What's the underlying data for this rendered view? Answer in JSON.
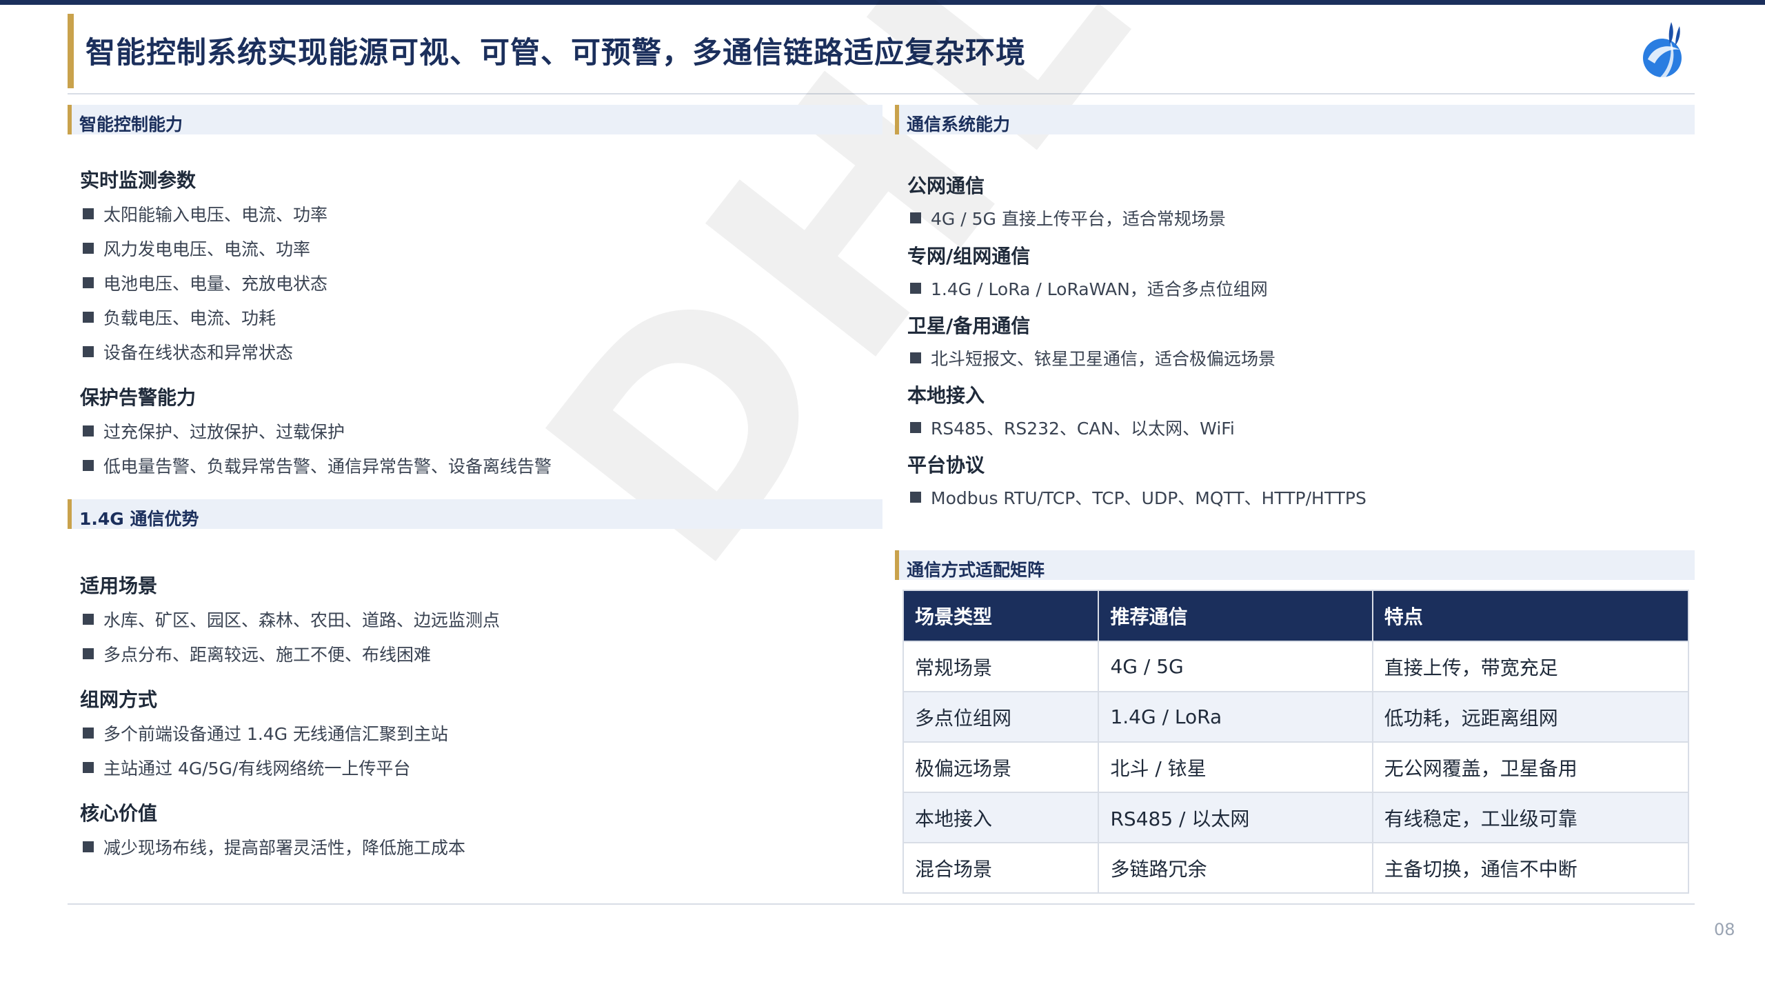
{
  "title": "智能控制系统实现能源可视、可管、可预警，多通信链路适应复杂环境",
  "page_number": "08",
  "watermark": "DHL",
  "colors": {
    "navy": "#1b2f5c",
    "gold": "#c9a24c",
    "section_bg": "#ebf0f8",
    "logo_blue": "#2a7de1"
  },
  "left": {
    "control": {
      "heading": "智能控制能力",
      "groups": [
        {
          "title": "实时监测参数",
          "items": [
            "太阳能输入电压、电流、功率",
            "风力发电电压、电流、功率",
            "电池电压、电量、充放电状态",
            "负载电压、电流、功耗",
            "设备在线状态和异常状态"
          ]
        },
        {
          "title": "保护告警能力",
          "items": [
            "过充保护、过放保护、过载保护",
            "低电量告警、负载异常告警、通信异常告警、设备离线告警"
          ]
        }
      ]
    },
    "lora": {
      "heading": "1.4G 通信优势",
      "groups": [
        {
          "title": "适用场景",
          "items": [
            "水库、矿区、园区、森林、农田、道路、边远监测点",
            "多点分布、距离较远、施工不便、布线困难"
          ]
        },
        {
          "title": "组网方式",
          "items": [
            "多个前端设备通过 1.4G 无线通信汇聚到主站",
            "主站通过 4G/5G/有线网络统一上传平台"
          ]
        },
        {
          "title": "核心价值",
          "items": [
            "减少现场布线，提高部署灵活性，降低施工成本"
          ]
        }
      ]
    }
  },
  "right": {
    "comm": {
      "heading": "通信系统能力",
      "groups": [
        {
          "title": "公网通信",
          "items": [
            "4G / 5G 直接上传平台，适合常规场景"
          ]
        },
        {
          "title": "专网/组网通信",
          "items": [
            "1.4G / LoRa / LoRaWAN，适合多点位组网"
          ]
        },
        {
          "title": "卫星/备用通信",
          "items": [
            "北斗短报文、铱星卫星通信，适合极偏远场景"
          ]
        },
        {
          "title": "本地接入",
          "items": [
            "RS485、RS232、CAN、以太网、WiFi"
          ]
        },
        {
          "title": "平台协议",
          "items": [
            "Modbus RTU/TCP、TCP、UDP、MQTT、HTTP/HTTPS"
          ]
        }
      ]
    },
    "matrix": {
      "heading": "通信方式适配矩阵",
      "columns": [
        "场景类型",
        "推荐通信",
        "特点"
      ],
      "rows": [
        [
          "常规场景",
          "4G / 5G",
          "直接上传，带宽充足"
        ],
        [
          "多点位组网",
          "1.4G / LoRa",
          "低功耗，远距离组网"
        ],
        [
          "极偏远场景",
          "北斗 / 铱星",
          "无公网覆盖，卫星备用"
        ],
        [
          "本地接入",
          "RS485 / 以太网",
          "有线稳定，工业级可靠"
        ],
        [
          "混合场景",
          "多链路冗余",
          "主备切换，通信不中断"
        ]
      ]
    }
  }
}
